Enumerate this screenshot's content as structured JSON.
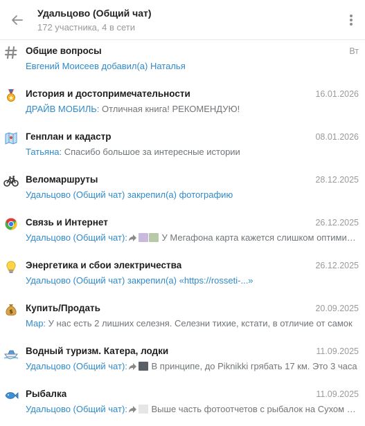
{
  "header": {
    "title": "Удальцово (Общий чат)",
    "subtitle": "172 участника, 4 в сети"
  },
  "topics": [
    {
      "icon": "hashtag-icon",
      "title": "Общие вопросы",
      "date": "Вт",
      "preview": {
        "sender": "",
        "text": "Евгений Моисеев добавил(а) Наталья",
        "media": [],
        "forwarded": false,
        "all_link": true
      }
    },
    {
      "icon": "medal-icon",
      "title": "История и достопримечательности",
      "date": "16.01.2026",
      "preview": {
        "sender": "ДРАЙВ МОБИЛЬ: ",
        "text": "Отличная книга! РЕКОМЕНДУЮ!",
        "media": [],
        "forwarded": false
      }
    },
    {
      "icon": "map-icon",
      "title": "Генплан и кадастр",
      "date": "08.01.2026",
      "preview": {
        "sender": "Татьяна: ",
        "text": "Спасибо большое за интересные истории",
        "media": [],
        "forwarded": false
      }
    },
    {
      "icon": "bicycle-icon",
      "title": "Веломаршруты",
      "date": "28.12.2025",
      "preview": {
        "sender": "",
        "text": "Удальцово (Общий чат) закрепил(а) фотографию",
        "media": [],
        "forwarded": false,
        "all_link": true
      }
    },
    {
      "icon": "chrome-icon",
      "title": "Связь и Интернет",
      "date": "26.12.2025",
      "preview": {
        "sender": "Удальцово (Общий чат):",
        "text": "У Мегафона карта кажется слишком оптимистичной",
        "media": [
          "#c9b9dc",
          "#b7c9a8"
        ],
        "forwarded": true
      }
    },
    {
      "icon": "lightbulb-icon",
      "title": "Энергетика и сбои электричества",
      "date": "26.12.2025",
      "preview": {
        "sender": "",
        "text": "Удальцово (Общий чат) закрепил(а) «https://rosseti-...»",
        "media": [],
        "forwarded": false,
        "all_link": true
      }
    },
    {
      "icon": "moneybag-icon",
      "title": "Купить/Продать",
      "date": "20.09.2025",
      "preview": {
        "sender": "Мар: ",
        "text": "У нас есть 2 лишних селезня. Селезни тихие, кстати, в отличие от самок",
        "media": [],
        "forwarded": false
      }
    },
    {
      "icon": "speedboat-icon",
      "title": "Водный туризм. Катера, лодки",
      "date": "11.09.2025",
      "preview": {
        "sender": "Удальцово (Общий чат):",
        "text": "В принципе, до Piknikki грябать 17 км. Это 3 часа",
        "media": [
          "#5a5f66"
        ],
        "forwarded": true
      }
    },
    {
      "icon": "fish-icon",
      "title": "Рыбалка",
      "date": "11.09.2025",
      "preview": {
        "sender": "Удальцово (Общий чат):",
        "text": "Выше часть фотоотчетов с рыбалок на Сухом озере",
        "media": [
          "#e6e6e6"
        ],
        "forwarded": true
      }
    }
  ],
  "colors": {
    "link": "#2f8ac9",
    "muted": "#9a9a9a",
    "title": "#1d1d1d"
  }
}
